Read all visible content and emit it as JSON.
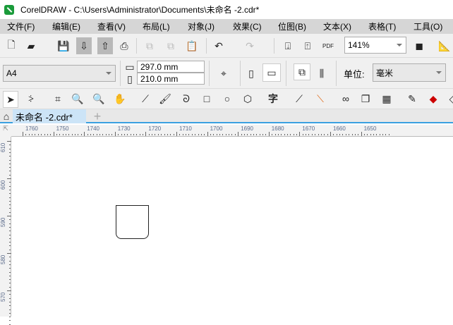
{
  "window": {
    "title": "CorelDRAW - C:\\Users\\Administrator\\Documents\\未命名 -2.cdr*"
  },
  "menu": [
    "文件(F)",
    "编辑(E)",
    "查看(V)",
    "布局(L)",
    "对象(J)",
    "效果(C)",
    "位图(B)",
    "文本(X)",
    "表格(T)",
    "工具(O)"
  ],
  "standard_toolbar": {
    "pdf_label": "PDF",
    "zoom_level": "141%"
  },
  "property_bar": {
    "page_size": "A4",
    "width": "297.0 mm",
    "height": "210.0 mm",
    "units_label": "单位:",
    "units_value": "毫米"
  },
  "document_tab": {
    "label": "未命名 -2.cdr*",
    "add": "+"
  },
  "ruler": {
    "horizontal": [
      "1760",
      "1750",
      "1740",
      "1730",
      "1720",
      "1710",
      "1700",
      "1690",
      "1680",
      "1670",
      "1660",
      "1650"
    ],
    "vertical": [
      "610",
      "600",
      "590",
      "580",
      "570"
    ]
  },
  "accent": "#3aa0e0"
}
